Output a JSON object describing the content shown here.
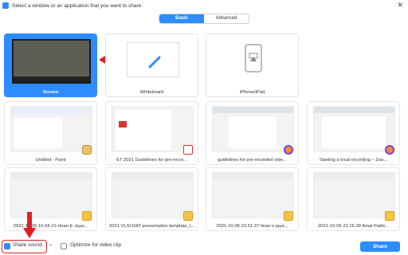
{
  "window": {
    "title": "Select a window or an application that you want to share",
    "close": "✕"
  },
  "tabs": {
    "basic": "Basic",
    "advanced": "Advanced"
  },
  "tiles": [
    {
      "label": "Screen"
    },
    {
      "label": "Whiteboard"
    },
    {
      "label": "iPhone/iPad"
    },
    {
      "label": "Untitled - Paint"
    },
    {
      "label": "ET 2021 Guidelines for pre-recor..."
    },
    {
      "label": "guidelines for pre-recorded vide..."
    },
    {
      "label": "Starting a local recording – Zoo..."
    },
    {
      "label": "2021-10-05 16.04.10 Hiran E Jaya..."
    },
    {
      "label": "2021 VLSI-DAT presentation template_I..."
    },
    {
      "label": "2021-10-05 23.51.37 hiran e jaya..."
    },
    {
      "label": "2021-10-05 22.16.39 Amal Pattiv..."
    }
  ],
  "footer": {
    "share_sound": "Share sound",
    "sound_dropdown": "⌄",
    "optimize_video": "Optimize for video clip",
    "share_button": "Share"
  },
  "colors": {
    "accent": "#2d8cff",
    "annotation": "#e02020"
  }
}
